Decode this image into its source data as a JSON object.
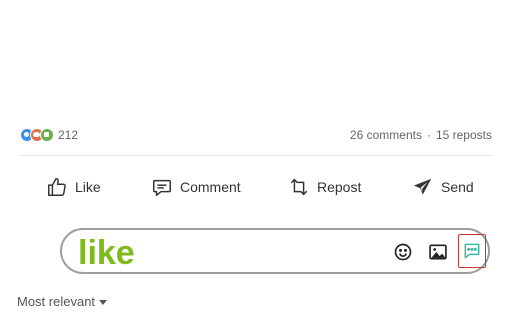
{
  "post_stats": {
    "reaction_icons": [
      "like-reaction-icon",
      "love-reaction-icon",
      "celebrate-reaction-icon"
    ],
    "reaction_count": "212",
    "comments": "26 comments",
    "separator": "·",
    "reposts": "15 reposts"
  },
  "actions": {
    "like": {
      "label": "Like",
      "icon": "thumbs-up-icon"
    },
    "comment": {
      "label": "Comment",
      "icon": "speech-bubble-icon"
    },
    "repost": {
      "label": "Repost",
      "icon": "repost-arrows-icon"
    },
    "send": {
      "label": "Send",
      "icon": "paper-plane-icon"
    }
  },
  "comment_box": {
    "value": "like",
    "text_color": "#7cbb18",
    "icons": [
      "emoji-icon",
      "image-icon",
      "message-dots-icon"
    ],
    "highlight_color": "#c0392b",
    "highlight_icon_color": "#3fb8a3"
  },
  "sort": {
    "label": "Most relevant",
    "icon": "caret-down-icon"
  }
}
